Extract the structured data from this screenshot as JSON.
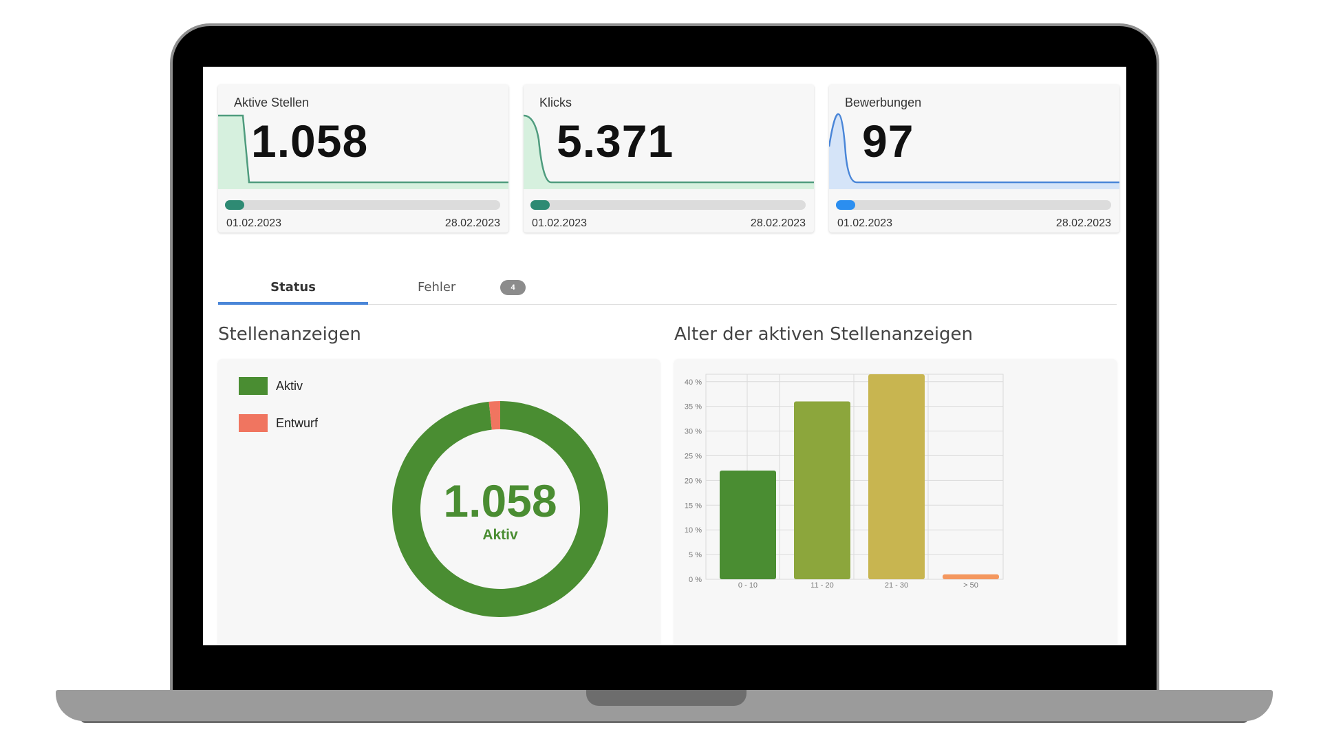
{
  "kpis": [
    {
      "label": "Aktive Stellen",
      "value": "1.058",
      "date_start": "01.02.2023",
      "date_end": "28.02.2023",
      "line_color": "#4f9c7e",
      "fill_color": "#d6f0de",
      "bar_color": "#2e8a73",
      "progress": 0.07
    },
    {
      "label": "Klicks",
      "value": "5.371",
      "date_start": "01.02.2023",
      "date_end": "28.02.2023",
      "line_color": "#4f9c7e",
      "fill_color": "#d6f0de",
      "bar_color": "#2e8a73",
      "progress": 0.07
    },
    {
      "label": "Bewerbungen",
      "value": "97",
      "date_start": "01.02.2023",
      "date_end": "28.02.2023",
      "line_color": "#4a86d8",
      "fill_color": "#d5e4f8",
      "bar_color": "#2b8ef0",
      "progress": 0.07
    }
  ],
  "tabs": {
    "status_label": "Status",
    "fehler_label": "Fehler",
    "fehler_count": "4",
    "active": "Status"
  },
  "sections": {
    "left_title": "Stellenanzeigen",
    "right_title": "Alter der aktiven Stellenanzeigen"
  },
  "legend": [
    {
      "label": "Aktiv",
      "color": "#4a8d32"
    },
    {
      "label": "Entwurf",
      "color": "#f07560"
    }
  ],
  "donut": {
    "center_value": "1.058",
    "center_label": "Aktiv",
    "slices": [
      {
        "name": "Aktiv",
        "value": 1058,
        "color": "#4a8d32"
      },
      {
        "name": "Entwurf",
        "value": 18,
        "color": "#f07560"
      }
    ]
  },
  "chart_data": {
    "type": "bar",
    "categories": [
      "0 - 10",
      "11 - 20",
      "21 - 30",
      "> 50"
    ],
    "values": [
      22,
      36,
      41.5,
      1
    ],
    "colors": [
      "#4a8d32",
      "#8ca63c",
      "#c8b550",
      "#f4975e"
    ],
    "y_ticks": [
      "0 %",
      "5 %",
      "10 %",
      "15 %",
      "20 %",
      "25 %",
      "30 %",
      "35 %",
      "40 %"
    ],
    "ylim": [
      0,
      41.5
    ],
    "grid": true
  }
}
